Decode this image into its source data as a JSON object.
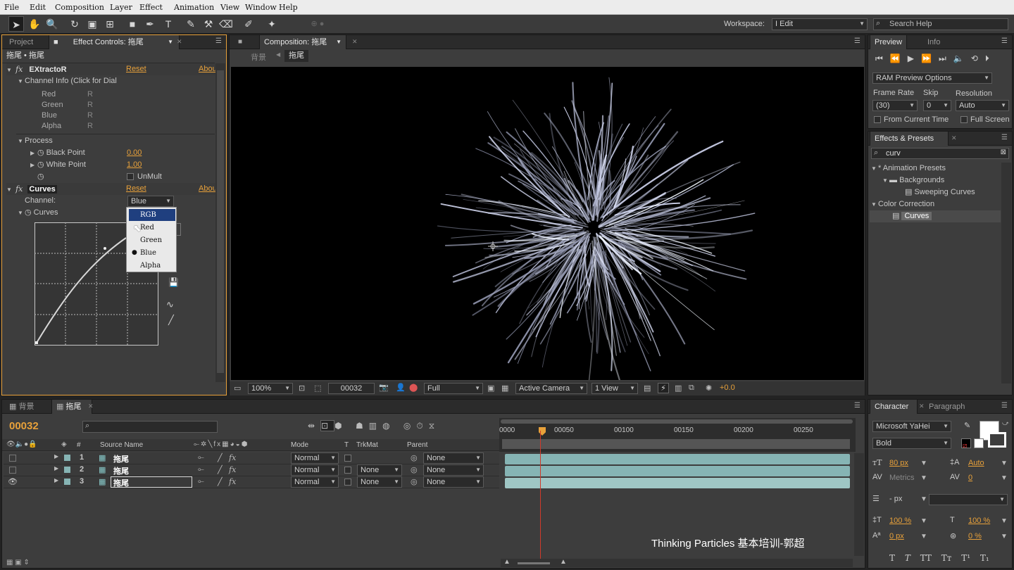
{
  "menu": [
    "File",
    "Edit",
    "Composition",
    "Layer",
    "Effect",
    "Animation",
    "View",
    "Window",
    "Help"
  ],
  "toolbar": {
    "workspace_label": "Workspace:",
    "workspace_value": "I Edit",
    "search_placeholder": "Search Help"
  },
  "effect_controls": {
    "tab_project": "Project",
    "tab_label": "Effect Controls: 拖尾",
    "header": "拖尾 • 拖尾",
    "extractor": {
      "name": "EXtractoR",
      "reset": "Reset",
      "about": "Abou",
      "channel_info": "Channel Info (Click for Dial",
      "channels": [
        {
          "name": "Red",
          "val": "R"
        },
        {
          "name": "Green",
          "val": "R"
        },
        {
          "name": "Blue",
          "val": "R"
        },
        {
          "name": "Alpha",
          "val": "R"
        }
      ],
      "process": "Process",
      "black_point_label": "Black Point",
      "black_point": "0.00",
      "white_point_label": "White Point",
      "white_point": "1.00",
      "unmult": "UnMult"
    },
    "curves": {
      "name": "Curves",
      "reset": "Reset",
      "about": "Abou",
      "channel_label": "Channel:",
      "channel_value": "Blue",
      "curves_label": "Curves",
      "options": [
        "RGB",
        "Red",
        "Green",
        "Blue",
        "Alpha"
      ],
      "selected": "Blue",
      "highlighted": "RGB"
    }
  },
  "composition": {
    "tab_label": "Composition: 拖尾",
    "breadcrumbs": [
      "背景",
      "拖尾"
    ],
    "zoom": "100%",
    "timecode": "00032",
    "resolution": "Full",
    "camera": "Active Camera",
    "views": "1 View",
    "exposure": "+0.0"
  },
  "preview": {
    "tab_preview": "Preview",
    "tab_info": "Info",
    "ram_options": "RAM Preview Options",
    "frame_rate_label": "Frame Rate",
    "skip_label": "Skip",
    "resolution_label": "Resolution",
    "frame_rate": "(30)",
    "skip": "0",
    "resolution": "Auto",
    "from_current": "From Current Time",
    "full_screen": "Full Screen"
  },
  "effects_presets": {
    "tab_label": "Effects & Presets",
    "search": "curv",
    "tree": [
      {
        "label": "* Animation Presets",
        "level": 0
      },
      {
        "label": "Backgrounds",
        "level": 1
      },
      {
        "label": "Sweeping Curves",
        "level": 2
      },
      {
        "label": "Color Correction",
        "level": 0
      },
      {
        "label": "Curves",
        "level": 1
      }
    ]
  },
  "timeline": {
    "tab_bg": "背景",
    "tab_main": "拖尾",
    "timecode": "00032",
    "columns": {
      "num": "#",
      "source": "Source Name",
      "mode": "Mode",
      "t": "T",
      "trkmat": "TrkMat",
      "parent": "Parent"
    },
    "ruler": [
      "0000",
      "00050",
      "00100",
      "00150",
      "00200",
      "00250"
    ],
    "layers": [
      {
        "num": "1",
        "name": "拖尾",
        "mode": "Normal",
        "trkmat": "",
        "parent": "None"
      },
      {
        "num": "2",
        "name": "拖尾",
        "mode": "Normal",
        "trkmat": "None",
        "parent": "None"
      },
      {
        "num": "3",
        "name": "拖尾",
        "mode": "Normal",
        "trkmat": "None",
        "parent": "None"
      }
    ],
    "watermark": "Thinking Particles 基本培训-郭超"
  },
  "character": {
    "tab_character": "Character",
    "tab_paragraph": "Paragraph",
    "font": "Microsoft YaHei",
    "style": "Bold",
    "size": "80 px",
    "leading": "Auto",
    "kerning": "Metrics",
    "tracking": "0",
    "stroke_width": "- px",
    "vscale": "100 %",
    "hscale": "100 %",
    "baseline": "0 px",
    "tsume": "0 %"
  },
  "colors": {
    "accent": "#e8a13a",
    "layer_bar": "#86b4b4",
    "playhead": "#d03a2a",
    "selected": "#1f3f7f"
  }
}
